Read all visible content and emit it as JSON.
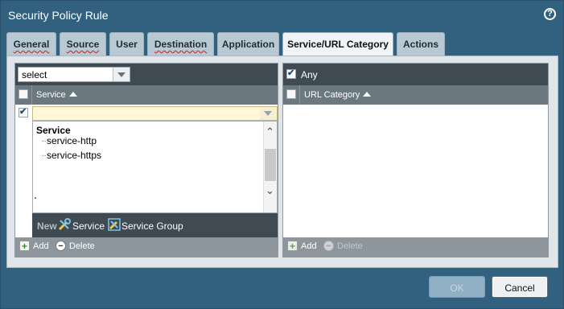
{
  "window": {
    "title": "Security Policy Rule",
    "help_label": "?"
  },
  "tabs": [
    {
      "label": "General",
      "active": false,
      "error": true
    },
    {
      "label": "Source",
      "active": false,
      "error": true
    },
    {
      "label": "User",
      "active": false,
      "error": false
    },
    {
      "label": "Destination",
      "active": false,
      "error": true
    },
    {
      "label": "Application",
      "active": false,
      "error": false
    },
    {
      "label": "Service/URL Category",
      "active": true,
      "error": false
    },
    {
      "label": "Actions",
      "active": false,
      "error": false
    }
  ],
  "service_panel": {
    "select_value": "select",
    "column_header": "Service",
    "dropdown": {
      "group": "Service",
      "items": [
        "service-http",
        "service-https"
      ]
    },
    "new_bar": {
      "new_label": "New",
      "service_label": "Service",
      "service_group_label": "Service Group"
    },
    "footer": {
      "add_label": "Add",
      "delete_label": "Delete"
    }
  },
  "url_panel": {
    "any_label": "Any",
    "any_checked": true,
    "column_header": "URL Category",
    "footer": {
      "add_label": "Add",
      "delete_label": "Delete"
    }
  },
  "buttons": {
    "ok_label": "OK",
    "cancel_label": "Cancel"
  }
}
